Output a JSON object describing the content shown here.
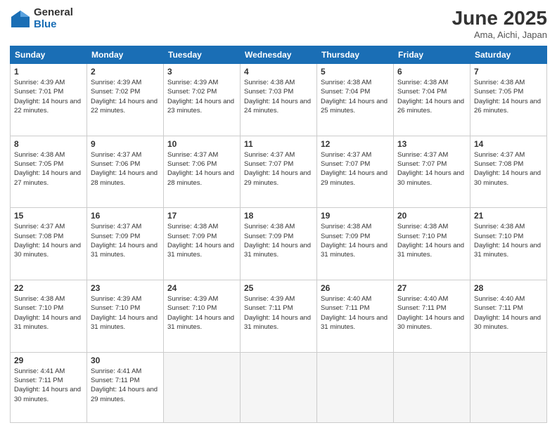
{
  "logo": {
    "general": "General",
    "blue": "Blue"
  },
  "title": "June 2025",
  "location": "Ama, Aichi, Japan",
  "headers": [
    "Sunday",
    "Monday",
    "Tuesday",
    "Wednesday",
    "Thursday",
    "Friday",
    "Saturday"
  ],
  "weeks": [
    [
      {
        "day": "1",
        "sunrise": "4:39 AM",
        "sunset": "7:01 PM",
        "daylight": "14 hours and 22 minutes."
      },
      {
        "day": "2",
        "sunrise": "4:39 AM",
        "sunset": "7:02 PM",
        "daylight": "14 hours and 22 minutes."
      },
      {
        "day": "3",
        "sunrise": "4:39 AM",
        "sunset": "7:02 PM",
        "daylight": "14 hours and 23 minutes."
      },
      {
        "day": "4",
        "sunrise": "4:38 AM",
        "sunset": "7:03 PM",
        "daylight": "14 hours and 24 minutes."
      },
      {
        "day": "5",
        "sunrise": "4:38 AM",
        "sunset": "7:04 PM",
        "daylight": "14 hours and 25 minutes."
      },
      {
        "day": "6",
        "sunrise": "4:38 AM",
        "sunset": "7:04 PM",
        "daylight": "14 hours and 26 minutes."
      },
      {
        "day": "7",
        "sunrise": "4:38 AM",
        "sunset": "7:05 PM",
        "daylight": "14 hours and 26 minutes."
      }
    ],
    [
      {
        "day": "8",
        "sunrise": "4:38 AM",
        "sunset": "7:05 PM",
        "daylight": "14 hours and 27 minutes."
      },
      {
        "day": "9",
        "sunrise": "4:37 AM",
        "sunset": "7:06 PM",
        "daylight": "14 hours and 28 minutes."
      },
      {
        "day": "10",
        "sunrise": "4:37 AM",
        "sunset": "7:06 PM",
        "daylight": "14 hours and 28 minutes."
      },
      {
        "day": "11",
        "sunrise": "4:37 AM",
        "sunset": "7:07 PM",
        "daylight": "14 hours and 29 minutes."
      },
      {
        "day": "12",
        "sunrise": "4:37 AM",
        "sunset": "7:07 PM",
        "daylight": "14 hours and 29 minutes."
      },
      {
        "day": "13",
        "sunrise": "4:37 AM",
        "sunset": "7:07 PM",
        "daylight": "14 hours and 30 minutes."
      },
      {
        "day": "14",
        "sunrise": "4:37 AM",
        "sunset": "7:08 PM",
        "daylight": "14 hours and 30 minutes."
      }
    ],
    [
      {
        "day": "15",
        "sunrise": "4:37 AM",
        "sunset": "7:08 PM",
        "daylight": "14 hours and 30 minutes."
      },
      {
        "day": "16",
        "sunrise": "4:37 AM",
        "sunset": "7:09 PM",
        "daylight": "14 hours and 31 minutes."
      },
      {
        "day": "17",
        "sunrise": "4:38 AM",
        "sunset": "7:09 PM",
        "daylight": "14 hours and 31 minutes."
      },
      {
        "day": "18",
        "sunrise": "4:38 AM",
        "sunset": "7:09 PM",
        "daylight": "14 hours and 31 minutes."
      },
      {
        "day": "19",
        "sunrise": "4:38 AM",
        "sunset": "7:09 PM",
        "daylight": "14 hours and 31 minutes."
      },
      {
        "day": "20",
        "sunrise": "4:38 AM",
        "sunset": "7:10 PM",
        "daylight": "14 hours and 31 minutes."
      },
      {
        "day": "21",
        "sunrise": "4:38 AM",
        "sunset": "7:10 PM",
        "daylight": "14 hours and 31 minutes."
      }
    ],
    [
      {
        "day": "22",
        "sunrise": "4:38 AM",
        "sunset": "7:10 PM",
        "daylight": "14 hours and 31 minutes."
      },
      {
        "day": "23",
        "sunrise": "4:39 AM",
        "sunset": "7:10 PM",
        "daylight": "14 hours and 31 minutes."
      },
      {
        "day": "24",
        "sunrise": "4:39 AM",
        "sunset": "7:10 PM",
        "daylight": "14 hours and 31 minutes."
      },
      {
        "day": "25",
        "sunrise": "4:39 AM",
        "sunset": "7:11 PM",
        "daylight": "14 hours and 31 minutes."
      },
      {
        "day": "26",
        "sunrise": "4:40 AM",
        "sunset": "7:11 PM",
        "daylight": "14 hours and 31 minutes."
      },
      {
        "day": "27",
        "sunrise": "4:40 AM",
        "sunset": "7:11 PM",
        "daylight": "14 hours and 30 minutes."
      },
      {
        "day": "28",
        "sunrise": "4:40 AM",
        "sunset": "7:11 PM",
        "daylight": "14 hours and 30 minutes."
      }
    ],
    [
      {
        "day": "29",
        "sunrise": "4:41 AM",
        "sunset": "7:11 PM",
        "daylight": "14 hours and 30 minutes."
      },
      {
        "day": "30",
        "sunrise": "4:41 AM",
        "sunset": "7:11 PM",
        "daylight": "14 hours and 29 minutes."
      },
      null,
      null,
      null,
      null,
      null
    ]
  ]
}
